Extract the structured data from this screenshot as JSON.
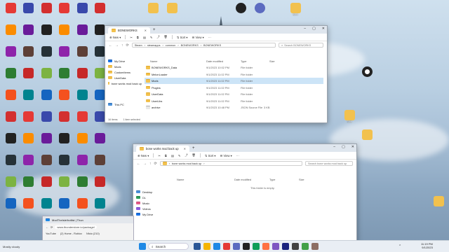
{
  "desktop": {
    "icons": [
      {
        "label": "",
        "color": "#e53935"
      },
      {
        "label": "",
        "color": "#c62828"
      },
      {
        "label": "",
        "color": "#6a1b9a"
      },
      {
        "label": "",
        "color": "#1565c0"
      },
      {
        "label": "",
        "color": "#263238"
      },
      {
        "label": "",
        "color": "#d32f2f"
      },
      {
        "label": "",
        "color": "#2e7d32"
      }
    ],
    "right_folder_labels": [
      "fsbm",
      "Stuff"
    ]
  },
  "explorer_top": {
    "tab_title": "BONEWORKS",
    "toolbar": {
      "new": "New",
      "sort": "Sort",
      "view": "View"
    },
    "breadcrumb": [
      "Steam",
      "steamapps",
      "common",
      "BONEWORKS",
      "BONEWORKS"
    ],
    "search_placeholder": "Search BONEWORKS",
    "sidebar": [
      "My Drive",
      "Mods",
      "CustomItems",
      "UserData",
      "bone works mod back up",
      "This PC"
    ],
    "columns": {
      "name": "Name",
      "date": "Date modified",
      "type": "Type",
      "size": "Size"
    },
    "files": [
      {
        "name": "BONEWORKS_Data",
        "date": "9/1/2023 10:02 PM",
        "type": "File folder",
        "size": ""
      },
      {
        "name": "MelonLoader",
        "date": "9/1/2023 11:02 PM",
        "type": "File folder",
        "size": ""
      },
      {
        "name": "Mods",
        "date": "9/1/2023 11:02 PM",
        "type": "File folder",
        "size": ""
      },
      {
        "name": "Plugins",
        "date": "9/1/2023 11:02 PM",
        "type": "File folder",
        "size": ""
      },
      {
        "name": "UserData",
        "date": "9/1/2023 11:02 PM",
        "type": "File folder",
        "size": ""
      },
      {
        "name": "UserLibs",
        "date": "9/1/2023 11:02 PM",
        "type": "File folder",
        "size": ""
      },
      {
        "name": "archive",
        "date": "9/1/2023 10:48 PM",
        "type": "JSON Source File",
        "size": "3 KB"
      }
    ],
    "status": {
      "items": "16 items",
      "selected": "1 item selected"
    }
  },
  "explorer_bottom": {
    "tab_title": "bone works mod back up",
    "toolbar": {
      "new": "New",
      "sort": "Sort",
      "view": "View"
    },
    "breadcrumb": [
      "bone works mod back up"
    ],
    "search_placeholder": "Search bone works mod back up",
    "sidebar": [
      "Desktop",
      "DL",
      "Music",
      "Videos",
      "My Drive"
    ],
    "columns": {
      "name": "Name",
      "date": "Date modified",
      "type": "Type",
      "size": "Size"
    },
    "empty_message": "This folder is empty."
  },
  "browser": {
    "tab_title": "ModTheIsle/hotlist | Thun",
    "url": "www.thunderstore.io/package/",
    "bookmarks": [
      "YouTube",
      "(2) Home - Roblox",
      "Nfoio (210)"
    ]
  },
  "taskbar": {
    "search_label": "Search",
    "weather": "Mostly cloudy",
    "time": "11:19 PM",
    "date": "9/1/2023"
  }
}
